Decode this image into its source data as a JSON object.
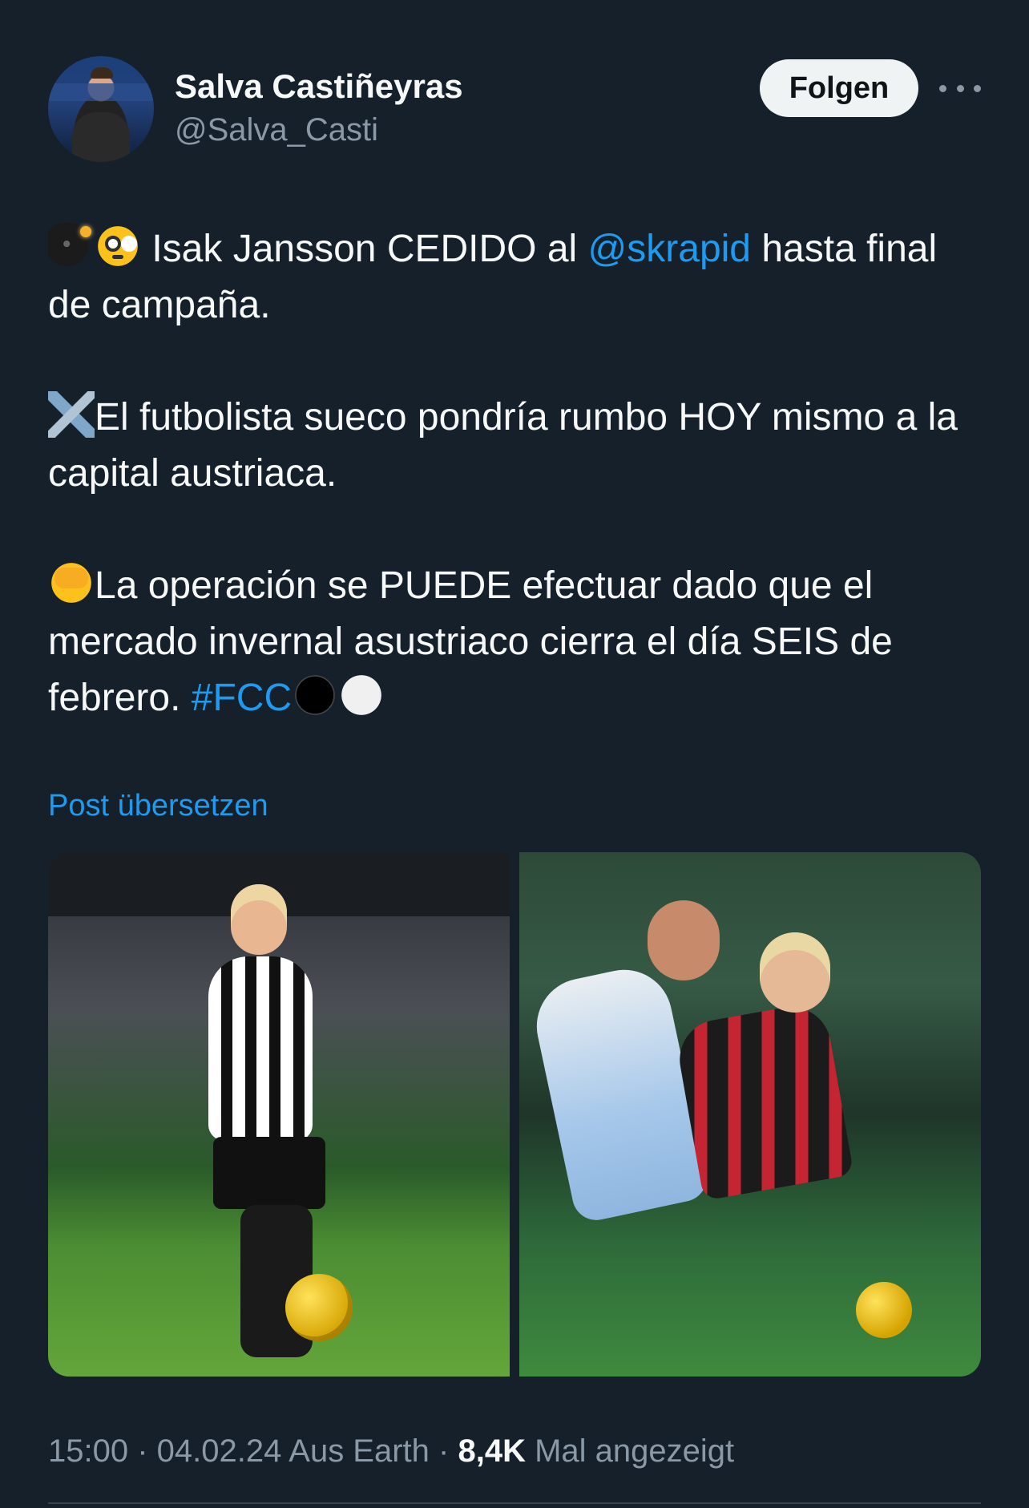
{
  "author": {
    "name": "Salva Castiñeyras",
    "handle": "@Salva_Casti",
    "follow_label": "Folgen"
  },
  "tweet": {
    "p1_text": " Isak Jansson CEDIDO al ",
    "p1_mention": "@skrapid",
    "p1_text_end": " hasta final de campaña.",
    "p2_text": "El futbolista sueco pondría rumbo HOY mismo a la capital austriaca.",
    "p3_text": "La operación se PUEDE efectuar dado que el mercado invernal asustriaco cierra el día SEIS de febrero. ",
    "p3_hashtag": "#FCC",
    "emojis": [
      "bomb-emoji",
      "flushed-face-emoji",
      "airplane-emoji",
      "face-peeking-emoji",
      "black-circle-emoji",
      "white-circle-emoji"
    ]
  },
  "translate_label": "Post übersetzen",
  "meta": {
    "time": "15:00",
    "sep1": " · ",
    "date": "04.02.24",
    "location": " Aus Earth",
    "sep2": " · ",
    "views_count": "8,4K",
    "views_label": " Mal angezeigt"
  },
  "colors": {
    "background": "#15202b",
    "link": "#1d9bf0",
    "muted": "#8b98a5"
  }
}
